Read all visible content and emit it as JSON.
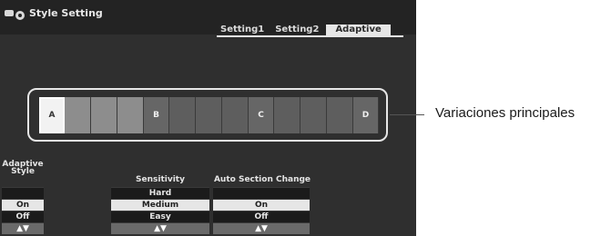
{
  "window": {
    "title": "Style Setting"
  },
  "tabs": [
    {
      "label": "Setting1",
      "active": false
    },
    {
      "label": "Setting2",
      "active": false
    },
    {
      "label": "Adaptive",
      "active": true
    }
  ],
  "variations": {
    "keys": [
      "A",
      "B",
      "C",
      "D"
    ],
    "selected": "A",
    "callout": "Variaciones principales"
  },
  "adaptive_style": {
    "label_line1": "Adaptive",
    "label_line2": "Style",
    "options": [
      "On",
      "Off"
    ],
    "selected": "On",
    "arrows": "▲▼"
  },
  "sensitivity": {
    "label": "Sensitivity",
    "options": [
      "Hard",
      "Medium",
      "Easy"
    ],
    "selected": "Medium",
    "arrows": "▲▼"
  },
  "auto_section_change": {
    "label": "Auto Section Change",
    "options": [
      "On",
      "Off"
    ],
    "selected": "On",
    "arrows": "▲▼"
  },
  "colors": {
    "screen_bg": "#2f2f2f",
    "highlight": "#e6e6e6"
  }
}
